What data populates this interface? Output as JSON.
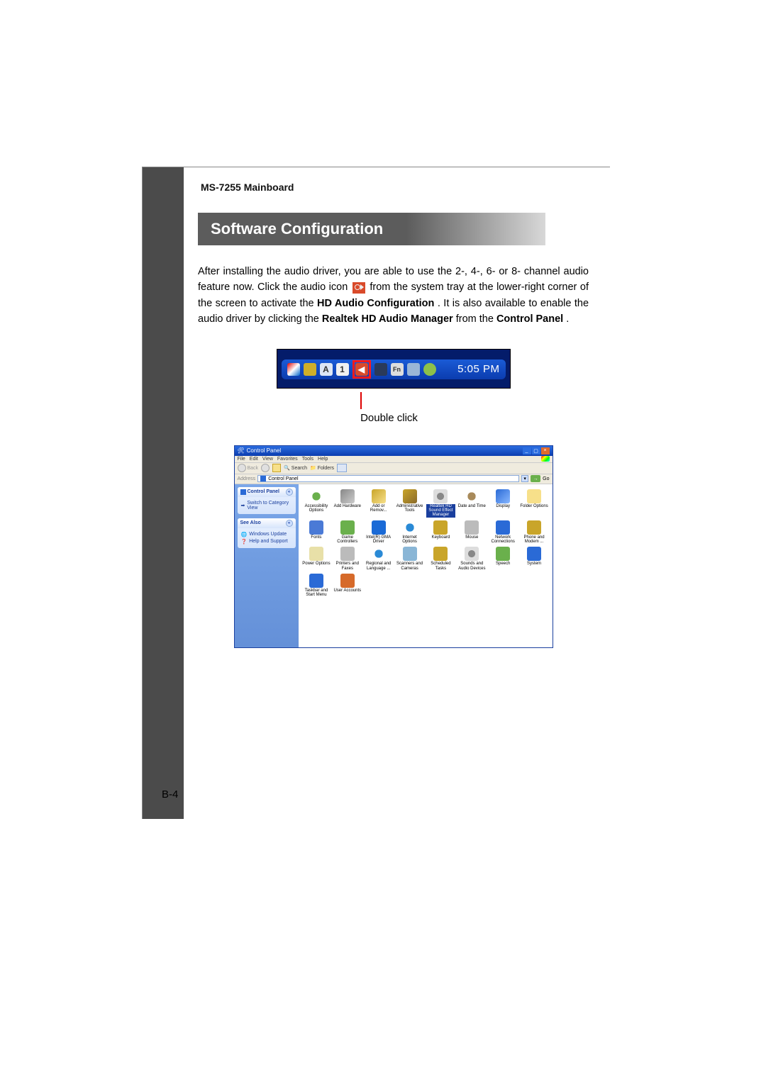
{
  "header": "MS-7255 Mainboard",
  "title": "Software Configuration",
  "para": {
    "t1": "After installing the audio driver, you are able to use the 2-, 4-, 6- or 8- channel audio feature now. Click the audio icon ",
    "t2": " from the system tray at the lower-right corner of the screen to activate the ",
    "b1": "HD Audio Configuration",
    "t3": ". It is also available to enable the audio driver by clicking the ",
    "b2": "Realtek HD Audio Manager",
    "t4": " from the ",
    "b3": "Control Panel",
    "t5": "."
  },
  "systray": {
    "time": "5:05 PM",
    "caption": "Double click"
  },
  "cp": {
    "title": "Control Panel",
    "menu": {
      "file": "File",
      "edit": "Edit",
      "view": "View",
      "fav": "Favorites",
      "tools": "Tools",
      "help": "Help"
    },
    "toolbar": {
      "back": "Back",
      "search": "Search",
      "folders": "Folders"
    },
    "address": {
      "label": "Address",
      "value": "Control Panel",
      "go": "Go"
    },
    "side": {
      "box1_title": "Control Panel",
      "box1_link": "Switch to Category View",
      "box2_title": "See Also",
      "box2_link1": "Windows Update",
      "box2_link2": "Help and Support"
    },
    "items": [
      "Accessibility Options",
      "Add Hardware",
      "Add or Remov...",
      "Administrative Tools",
      "Realtek HD Sound Effect Manager",
      "Date and Time",
      "Display",
      "Folder Options",
      "Fonts",
      "Game Controllers",
      "Intel(R) GMA Driver",
      "Internet Options",
      "Keyboard",
      "Mouse",
      "Network Connections",
      "Phone and Modem ...",
      "Power Options",
      "Printers and Faxes",
      "Regional and Language ...",
      "Scanners and Cameras",
      "Scheduled Tasks",
      "Sounds and Audio Devices",
      "Speech",
      "System",
      "Taskbar and Start Menu",
      "User Accounts"
    ]
  },
  "page_number": "B-4"
}
